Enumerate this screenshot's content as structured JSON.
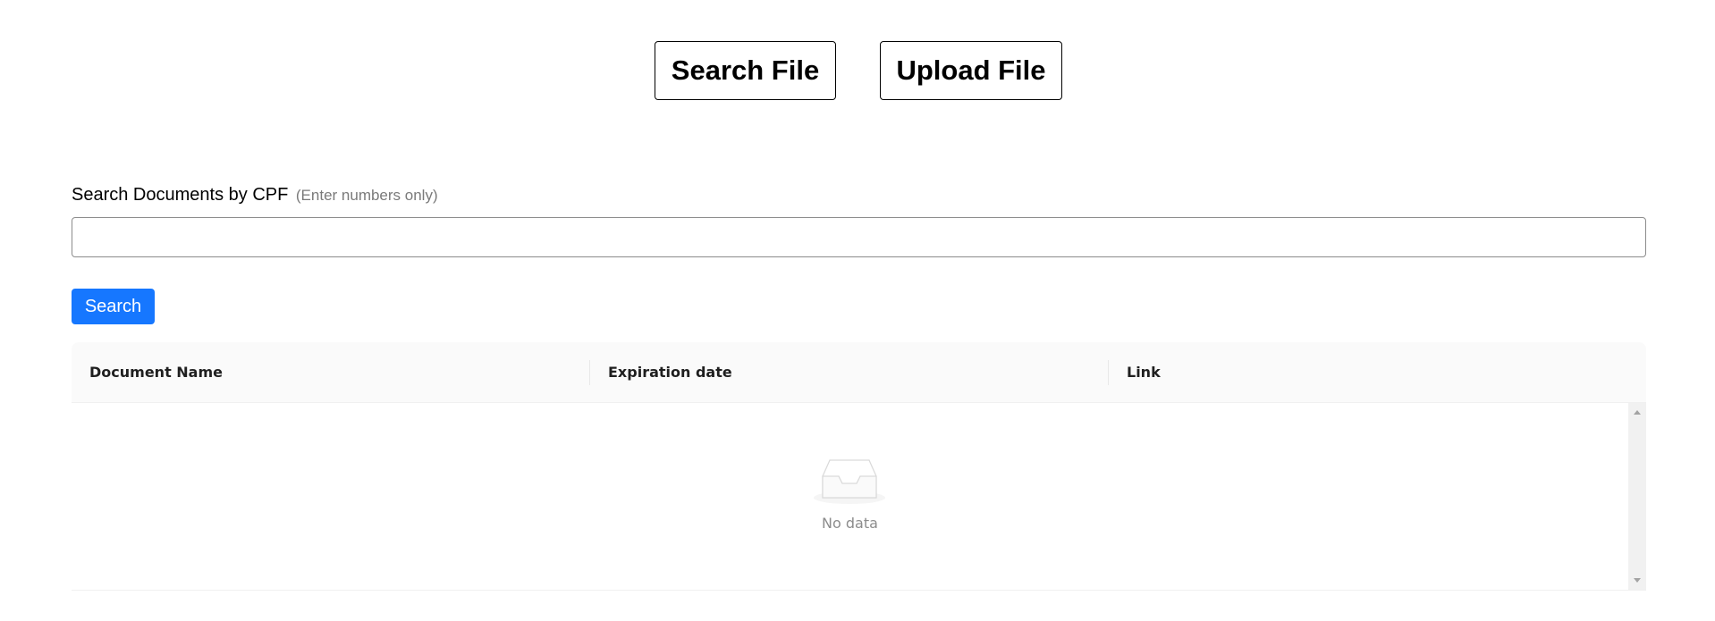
{
  "nav": {
    "search_label": "Search File",
    "upload_label": "Upload File"
  },
  "search_form": {
    "label": "Search Documents by CPF",
    "hint": "(Enter numbers only)",
    "input_value": "",
    "placeholder": "",
    "button_label": "Search"
  },
  "table": {
    "columns": [
      "Document Name",
      "Expiration date",
      "Link"
    ],
    "rows": [],
    "empty_text": "No data"
  },
  "colors": {
    "primary": "#1677ff",
    "header_bg": "#fafafa",
    "muted_text": "#8c8c8c"
  },
  "icons": {
    "empty": "inbox-icon",
    "scroll_up": "scroll-up-arrow-icon",
    "scroll_down": "scroll-down-arrow-icon"
  }
}
